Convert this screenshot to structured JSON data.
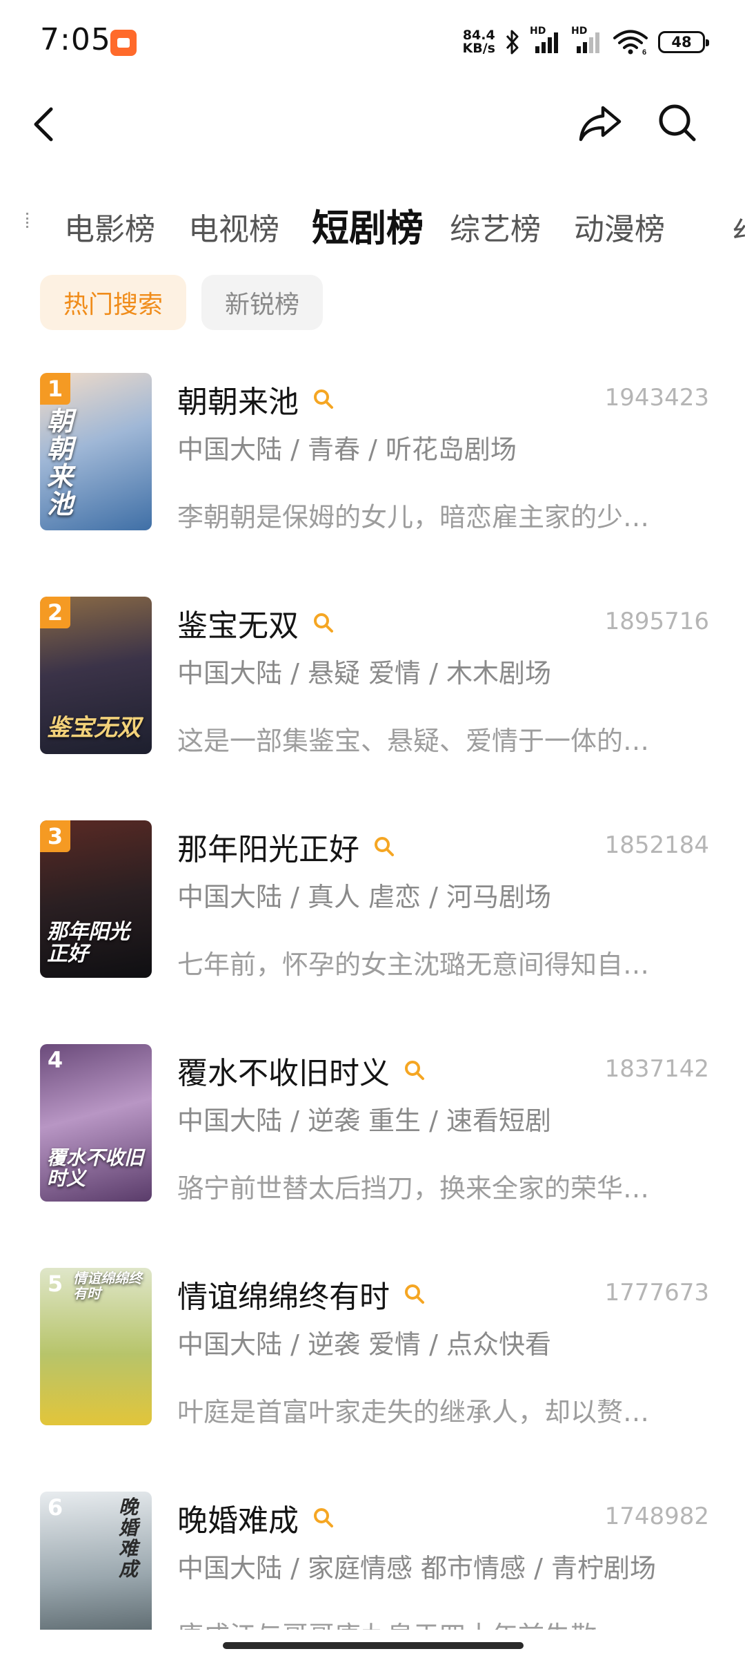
{
  "status_bar": {
    "time": "7:05",
    "net_speed_value": "84.4",
    "net_speed_unit": "KB/s",
    "signal1_label": "HD",
    "signal2_label": "HD",
    "wifi_label": "6",
    "battery": "48"
  },
  "nav": {
    "back_icon": "chevron-left-icon",
    "share_icon": "share-icon",
    "search_icon": "search-icon"
  },
  "tabs": {
    "items": [
      "电影榜",
      "电视榜",
      "短剧榜",
      "综艺榜",
      "动漫榜"
    ],
    "active": "短剧榜"
  },
  "chips": {
    "items": [
      "热门搜索",
      "新锐榜"
    ],
    "active": "热门搜索"
  },
  "list": [
    {
      "rank": "1",
      "title": "朝朝来池",
      "count": "1943423",
      "meta": "中国大陆 / 青春 / 听花岛剧场",
      "desc": "李朝朝是保姆的女儿，暗恋雇主家的少…",
      "poster_text": "朝朝来池",
      "rank_color": "#f59a23"
    },
    {
      "rank": "2",
      "title": "鉴宝无双",
      "count": "1895716",
      "meta": "中国大陆 / 悬疑 爱情 / 木木剧场",
      "desc": "这是一部集鉴宝、悬疑、爱情于一体的…",
      "poster_text": "鉴宝无双",
      "rank_color": "#f59a23"
    },
    {
      "rank": "3",
      "title": "那年阳光正好",
      "count": "1852184",
      "meta": "中国大陆 / 真人 虐恋 / 河马剧场",
      "desc": "七年前，怀孕的女主沈璐无意间得知自…",
      "poster_text": "那年阳光正好",
      "rank_color": "#f59a23"
    },
    {
      "rank": "4",
      "title": "覆水不收旧时义",
      "count": "1837142",
      "meta": "中国大陆 / 逆袭 重生 / 速看短剧",
      "desc": "骆宁前世替太后挡刀，换来全家的荣华…",
      "poster_text": "覆水不收旧时义",
      "rank_color": "transparent"
    },
    {
      "rank": "5",
      "title": "情谊绵绵终有时",
      "count": "1777673",
      "meta": "中国大陆 / 逆袭 爱情 / 点众快看",
      "desc": "叶庭是首富叶家走失的继承人，却以赘…",
      "poster_text": "情谊绵绵终有时",
      "rank_color": "transparent"
    },
    {
      "rank": "6",
      "title": "晚婚难成",
      "count": "1748982",
      "meta": "中国大陆 / 家庭情感 都市情感 / 青柠剧场",
      "desc": "唐成江与哥哥唐九皇于四十年前失散…",
      "poster_text": "晚婚难成",
      "rank_color": "transparent"
    }
  ],
  "colors": {
    "accent": "#f08c1a",
    "rank_badge": "#f59a23",
    "hot_icon": "#f5a623",
    "chip_active_bg": "#fdf1e2"
  }
}
